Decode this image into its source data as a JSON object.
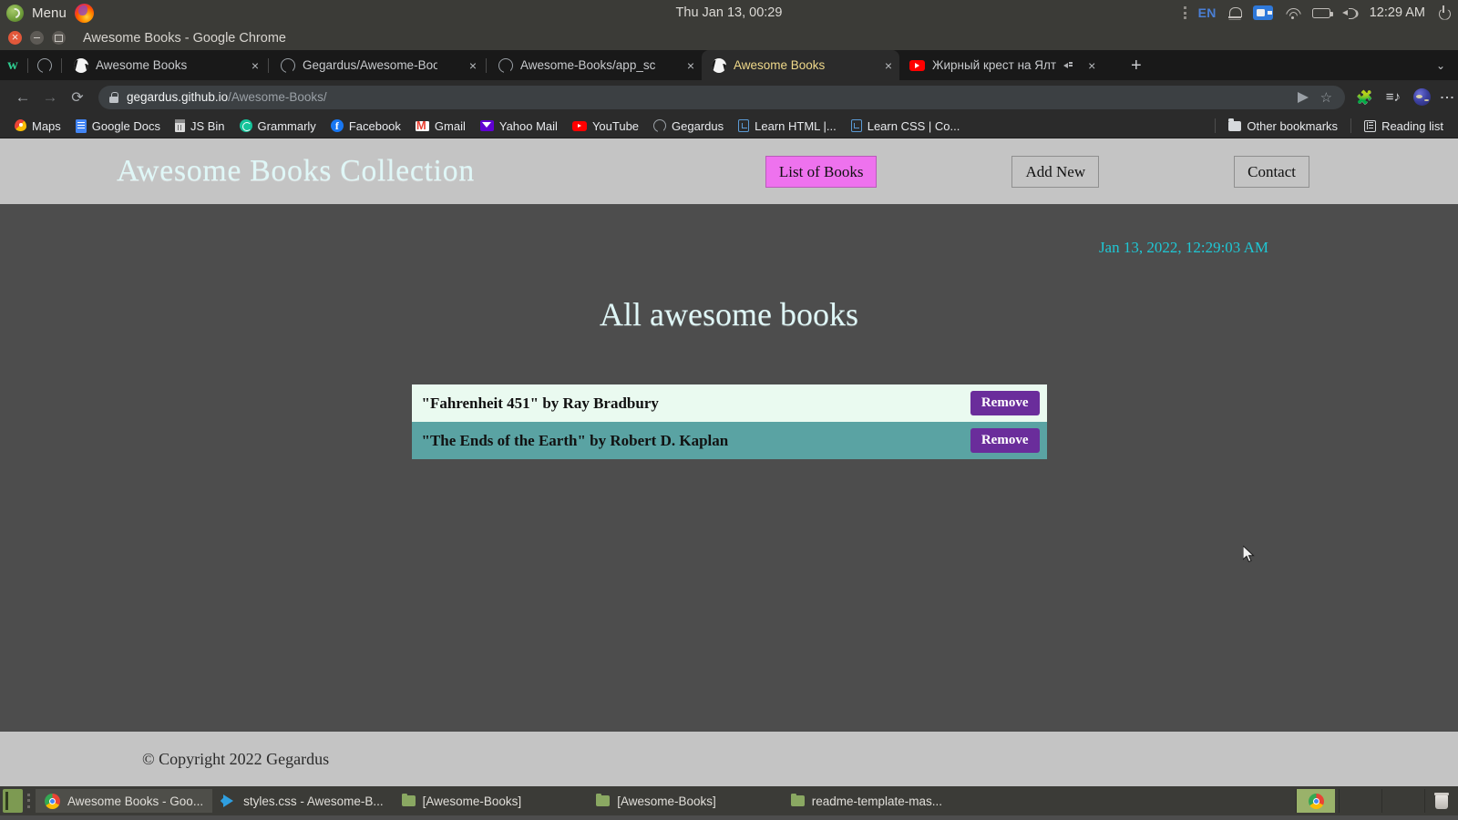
{
  "os_panel": {
    "menu_label": "Menu",
    "firefox_icon": "firefox-icon",
    "center_clock": "Thu Jan 13, 00:29",
    "language": "EN",
    "tray_time": "12:29 AM",
    "tray_icons": [
      "bell-icon",
      "video-camera-icon",
      "wifi-icon",
      "battery-icon",
      "volume-icon",
      "power-icon"
    ]
  },
  "window": {
    "title": "Awesome Books - Google Chrome",
    "buttons": [
      "close-button",
      "minimize-button",
      "maximize-button"
    ]
  },
  "browser": {
    "tabs": [
      {
        "label": "Awesome Books",
        "favicon": "globe-icon",
        "active": false,
        "close": "×"
      },
      {
        "label": "Gegardus/Awesome-Book",
        "favicon": "github-icon",
        "active": false,
        "close": "×"
      },
      {
        "label": "Awesome-Books/app_scr",
        "favicon": "github-icon",
        "active": false,
        "close": "×"
      },
      {
        "label": "Awesome Books",
        "favicon": "globe-icon",
        "active": true,
        "close": "×"
      },
      {
        "label": "Жирный крест на Ялт",
        "favicon": "youtube-icon",
        "active": false,
        "close": "×"
      }
    ],
    "new_tab_label": "+",
    "tab_list_caret": "⌄",
    "nav": {
      "back": "←",
      "forward": "→",
      "reload": "⟳"
    },
    "omnibox": {
      "lock": "lock-icon",
      "url_host": "gegardus.github.io",
      "url_path": "/Awesome-Books/",
      "send_icon": "send-to-devices-icon",
      "star_icon": "☆"
    },
    "toolbar_icons": [
      "extensions-puzzle-icon",
      "reading-list-icon",
      "profile-avatar",
      "chrome-menu-icon"
    ],
    "bookmarks": [
      {
        "label": "Maps",
        "icon": "maps-icon"
      },
      {
        "label": "Google Docs",
        "icon": "google-docs-icon"
      },
      {
        "label": "JS Bin",
        "icon": "jsbin-icon"
      },
      {
        "label": "Grammarly",
        "icon": "grammarly-icon"
      },
      {
        "label": "Facebook",
        "icon": "facebook-icon"
      },
      {
        "label": "Gmail",
        "icon": "gmail-icon"
      },
      {
        "label": "Yahoo Mail",
        "icon": "yahoo-mail-icon"
      },
      {
        "label": "YouTube",
        "icon": "youtube-icon"
      },
      {
        "label": "Gegardus",
        "icon": "github-icon"
      },
      {
        "label": "Learn HTML |...",
        "icon": "code-icon"
      },
      {
        "label": "Learn CSS | Co...",
        "icon": "code-icon"
      }
    ],
    "other_bookmarks": {
      "label": "Other bookmarks",
      "icon": "folder-icon"
    },
    "reading_list": {
      "label": "Reading list",
      "icon": "reading-list-icon"
    }
  },
  "page": {
    "site_title": "Awesome Books Collection",
    "nav_items": [
      {
        "label": "List of Books",
        "active": true
      },
      {
        "label": "Add New",
        "active": false
      },
      {
        "label": "Contact",
        "active": false
      }
    ],
    "timestamp": "Jan 13, 2022, 12:29:03 AM",
    "heading": "All awesome books",
    "books": [
      {
        "text": "\"Fahrenheit 451\" by Ray Bradbury",
        "button": "Remove"
      },
      {
        "text": "\"The Ends of the Earth\" by Robert D. Kaplan",
        "button": "Remove"
      }
    ],
    "footer": "© Copyright 2022 Gegardus",
    "colors": {
      "header_bg": "#c4c4c4",
      "page_bg": "#4d4d4d",
      "title_text": "#dff7f7",
      "timestamp_text": "#1fc7d4",
      "active_nav_bg": "#ee72ee",
      "row_light_bg": "#eafaf0",
      "row_teal_bg": "#5aa3a3",
      "remove_btn_bg": "#6a2d9b"
    }
  },
  "taskbar": {
    "items": [
      {
        "label": "Awesome Books - Goo...",
        "icon": "chrome-icon",
        "active": true
      },
      {
        "label": "styles.css - Awesome-B...",
        "icon": "vscode-icon",
        "active": false
      },
      {
        "label": "[Awesome-Books]",
        "icon": "folder-icon",
        "active": false
      },
      {
        "label": "[Awesome-Books]",
        "icon": "folder-icon",
        "active": false
      },
      {
        "label": "readme-template-mas...",
        "icon": "folder-icon",
        "active": false
      }
    ],
    "launcher_icon": "chrome-launcher-icon",
    "trash_icon": "trash-icon",
    "show_desktop_icon": "show-desktop-icon"
  }
}
